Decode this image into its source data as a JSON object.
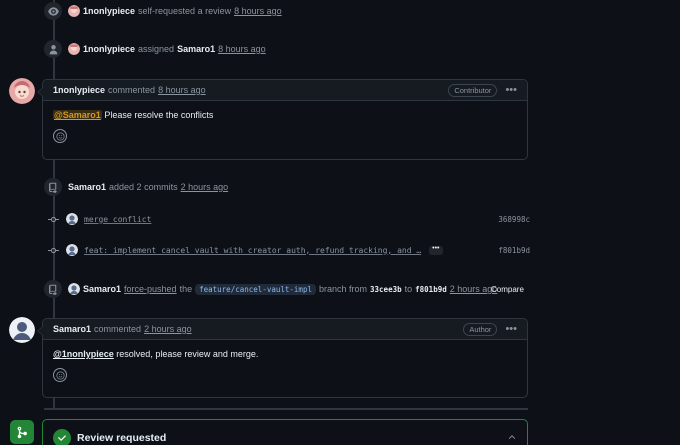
{
  "events": {
    "self_review": {
      "user": "1nonlypiece",
      "action": "self-requested a review",
      "time": "8 hours ago"
    },
    "assigned": {
      "user": "1nonlypiece",
      "action": "assigned",
      "target": "Samaro1",
      "time": "8 hours ago"
    },
    "added_commits": {
      "user": "Samaro1",
      "action": "added 2 commits",
      "time": "2 hours ago"
    },
    "force_push": {
      "user": "Samaro1",
      "action": "force-pushed",
      "the": "the",
      "branch": "feature/cancel-vault-impl",
      "branch_word": "branch from",
      "from_sha": "33cee3b",
      "to_word": "to",
      "to_sha": "f801b9d",
      "time": "2 hours ago",
      "compare_label": "Compare"
    }
  },
  "comment1": {
    "user": "1nonlypiece",
    "verb": "commented",
    "time": "8 hours ago",
    "role": "Contributor",
    "mention": "@Samaro1",
    "body": " Please resolve the conflicts"
  },
  "commits": [
    {
      "message": "merge conflict",
      "sha": "368998c"
    },
    {
      "message": "feat: implement cancel_vault with creator auth, refund tracking, and …",
      "sha": "f801b9d",
      "more": "•••"
    }
  ],
  "comment2": {
    "user": "Samaro1",
    "verb": "commented",
    "time": "2 hours ago",
    "role": "Author",
    "mention": "@1nonlypiece",
    "body": " resolved, please review and merge."
  },
  "review": {
    "title": "Review requested"
  },
  "kebab": "•••",
  "colors": {
    "background": "#0d1117",
    "panel": "#161b22",
    "border": "#30363d",
    "success": "#238636",
    "mention_highlight": "#d29922"
  }
}
